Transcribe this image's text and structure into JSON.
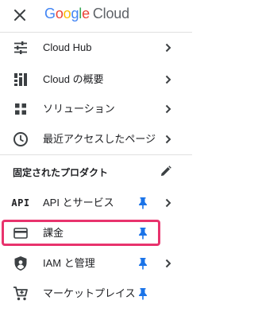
{
  "header": {
    "logo_google": [
      "G",
      "o",
      "o",
      "g",
      "l",
      "e"
    ],
    "logo_cloud": "Cloud",
    "logo_colors": [
      "#4285F4",
      "#EA4335",
      "#FBBC05",
      "#4285F4",
      "#34A853",
      "#EA4335"
    ]
  },
  "nav": {
    "items": [
      {
        "label": "Cloud Hub",
        "icon": "tune-sliders-icon"
      },
      {
        "label": "Cloud の概要",
        "icon": "dashboard-icon"
      },
      {
        "label": "ソリューション",
        "icon": "apps-grid-icon"
      },
      {
        "label": "最近アクセスしたページ",
        "icon": "clock-icon"
      }
    ]
  },
  "pinned": {
    "title": "固定されたプロダクト",
    "items": [
      {
        "label": "API とサービス",
        "icon_text": "API"
      },
      {
        "label": "課金",
        "icon": "billing-card-icon"
      },
      {
        "label": "IAM と管理",
        "icon": "shield-icon"
      },
      {
        "label": "マーケットプレイス",
        "icon": "cart-icon"
      }
    ]
  },
  "colors": {
    "accent": "#1a73e8",
    "highlight": "#e8336d",
    "icon": "#3c4043"
  }
}
